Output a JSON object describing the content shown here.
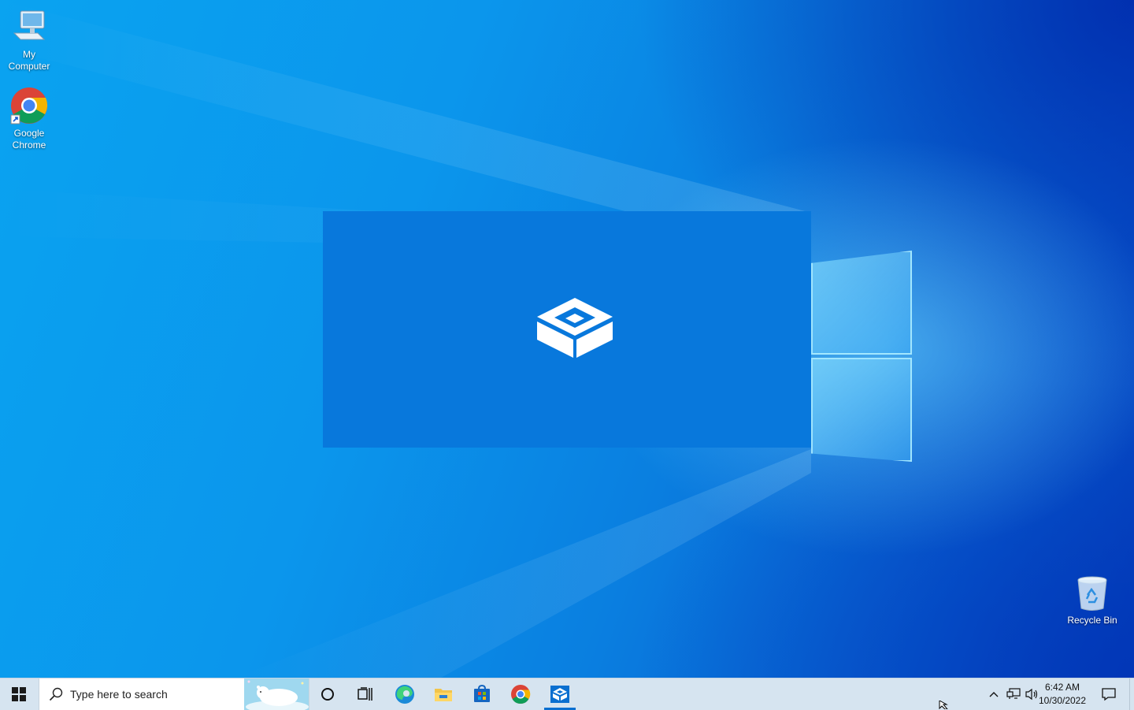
{
  "desktop": {
    "icons": [
      {
        "label": "My Computer",
        "icon": "computer-icon"
      },
      {
        "label": "Google Chrome",
        "icon": "chrome-icon"
      },
      {
        "label": "Recycle Bin",
        "icon": "recycle-bin-icon"
      }
    ]
  },
  "splash": {
    "icon": "sandbox-box-icon",
    "color": "#0878dc"
  },
  "taskbar": {
    "start_icon": "windows-start-icon",
    "search_placeholder": "Type here to search",
    "pinned": [
      {
        "name": "cortana-icon"
      },
      {
        "name": "task-view-icon"
      },
      {
        "name": "edge-icon"
      },
      {
        "name": "file-explorer-icon"
      },
      {
        "name": "microsoft-store-icon"
      },
      {
        "name": "chrome-icon"
      },
      {
        "name": "windows-sandbox-icon",
        "active": true
      }
    ],
    "tray": {
      "time": "6:42 AM",
      "date": "10/30/2022",
      "icons": [
        "chevron-up-icon",
        "network-icon",
        "volume-icon",
        "notifications-icon"
      ]
    }
  },
  "colors": {
    "accent": "#0a6fd0",
    "taskbar": "#d6e4f0",
    "desktop": "#0a8cea"
  }
}
